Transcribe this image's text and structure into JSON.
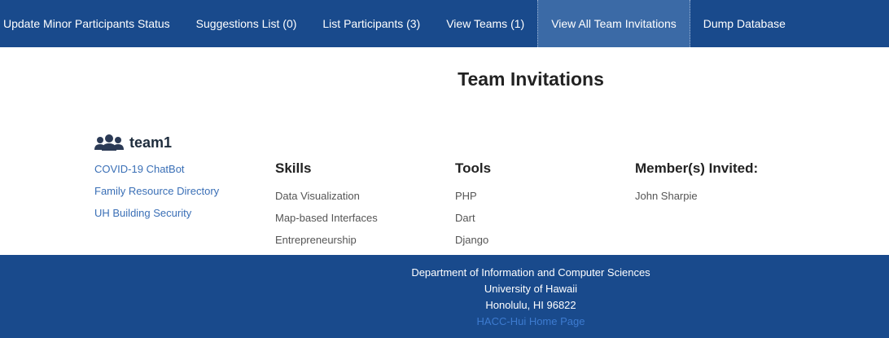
{
  "nav": {
    "items": [
      {
        "label": "Update Minor Participants Status"
      },
      {
        "label": "Suggestions List (0)"
      },
      {
        "label": "List Participants (3)"
      },
      {
        "label": "View Teams (1)"
      },
      {
        "label": "View All Team Invitations"
      },
      {
        "label": "Dump Database"
      }
    ],
    "active_index": 4
  },
  "page": {
    "title": "Team Invitations"
  },
  "team": {
    "icon": "users-icon",
    "name": "team1",
    "challenges": [
      "COVID-19 ChatBot",
      "Family Resource Directory",
      "UH Building Security"
    ],
    "skills_heading": "Skills",
    "skills": [
      "Data Visualization",
      "Map-based Interfaces",
      "Entrepreneurship"
    ],
    "tools_heading": "Tools",
    "tools": [
      "PHP",
      "Dart",
      "Django"
    ],
    "members_heading": "Member(s) Invited:",
    "members": [
      "John Sharpie"
    ]
  },
  "footer": {
    "line1": "Department of Information and Computer Sciences",
    "line2": "University of Hawaii",
    "line3": "Honolulu, HI 96822",
    "link": "HACC-Hui Home Page"
  },
  "colors": {
    "nav_bg": "#194a8c",
    "nav_active_bg": "#3b6aa6",
    "link": "#3a6fb6"
  }
}
